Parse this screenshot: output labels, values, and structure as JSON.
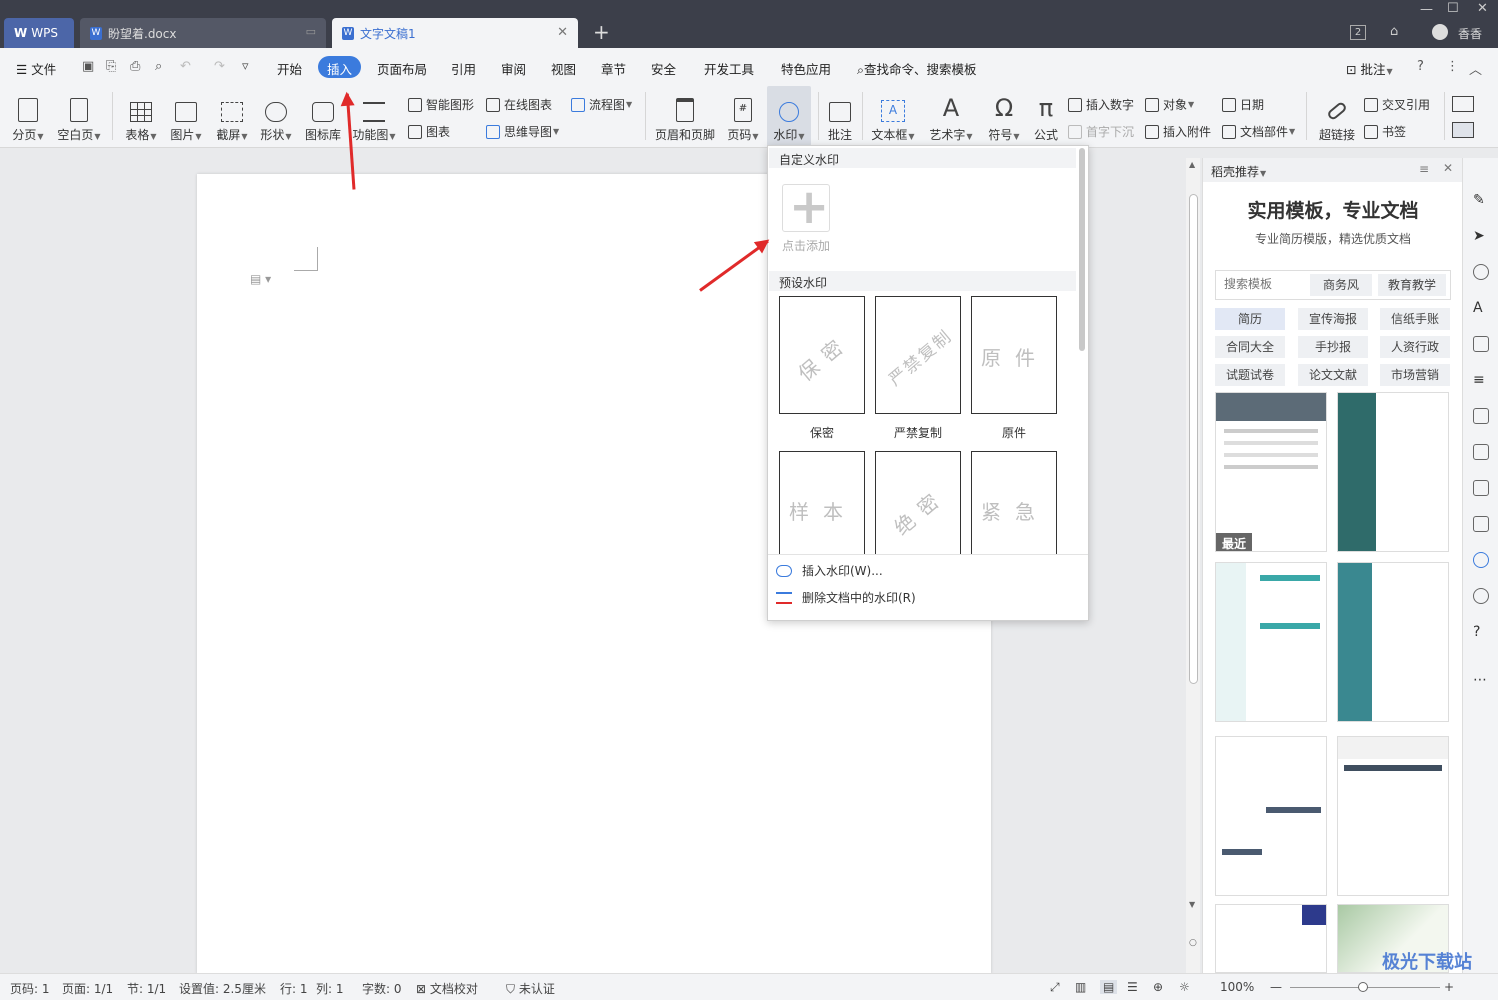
{
  "tabs": {
    "wps": "WPS",
    "doc1": "盼望着.docx",
    "doc2": "文字文稿1"
  },
  "titlebar": {
    "count": "2",
    "user": "香香"
  },
  "menu": {
    "file": "文件",
    "items": [
      "开始",
      "插入",
      "页面布局",
      "引用",
      "审阅",
      "视图",
      "章节",
      "安全",
      "开发工具",
      "特色应用"
    ],
    "active": "插入",
    "search": "查找命令、搜索模板",
    "comment": "批注"
  },
  "ribbon": {
    "pagebreak": "分页",
    "blankpage": "空白页",
    "table": "表格",
    "picture": "图片",
    "screenshot": "截屏",
    "shape": "形状",
    "iconlib": "图标库",
    "funcchart": "功能图",
    "smartart": "智能图形",
    "onlinechart": "在线图表",
    "flowchart": "流程图",
    "chart": "图表",
    "mindmap": "思维导图",
    "headerfooter": "页眉和页脚",
    "pagenum": "页码",
    "watermark": "水印",
    "comment": "批注",
    "textbox": "文本框",
    "wordart": "艺术字",
    "symbol": "符号",
    "formula": "公式",
    "insertnum": "插入数字",
    "object": "对象",
    "date": "日期",
    "dropcap": "首字下沉",
    "attach": "插入附件",
    "docpart": "文档部件",
    "hyperlink": "超链接",
    "crossref": "交叉引用",
    "bookmark": "书签"
  },
  "watermark_menu": {
    "custom_title": "自定义水印",
    "add_label": "点击添加",
    "preset_title": "预设水印",
    "presets": [
      {
        "text": "保密",
        "label": "保密"
      },
      {
        "text": "严禁复制",
        "label": "严禁复制"
      },
      {
        "text": "原件",
        "label": "原件"
      },
      {
        "text": "样本",
        "label": ""
      },
      {
        "text": "绝密",
        "label": ""
      },
      {
        "text": "紧急",
        "label": ""
      }
    ],
    "insert": "插入水印(W)...",
    "delete": "删除文档中的水印(R)"
  },
  "panel": {
    "title": "稻壳推荐",
    "headline": "实用模板，专业文档",
    "subline": "专业简历模版，精选优质文档",
    "search_placeholder": "搜索模板",
    "tags": [
      "商务风",
      "教育教学"
    ],
    "categories": [
      "简历",
      "宣传海报",
      "信纸手账",
      "合同大全",
      "手抄报",
      "人资行政",
      "试题试卷",
      "论文文献",
      "市场营销"
    ],
    "recent_badge": "最近"
  },
  "status": {
    "page": "页码: 1",
    "pages": "页面: 1/1",
    "section": "节: 1/1",
    "setting": "设置值: 2.5厘米",
    "row": "行: 1",
    "col": "列: 1",
    "words": "字数: 0",
    "proof": "文档校对",
    "auth": "未认证",
    "zoom": "100%"
  },
  "watermark_site": "极光下载站",
  "colors": {
    "accent": "#3b7bdd",
    "arrow": "#e02a2a",
    "titlebar": "#3c3f4a"
  }
}
